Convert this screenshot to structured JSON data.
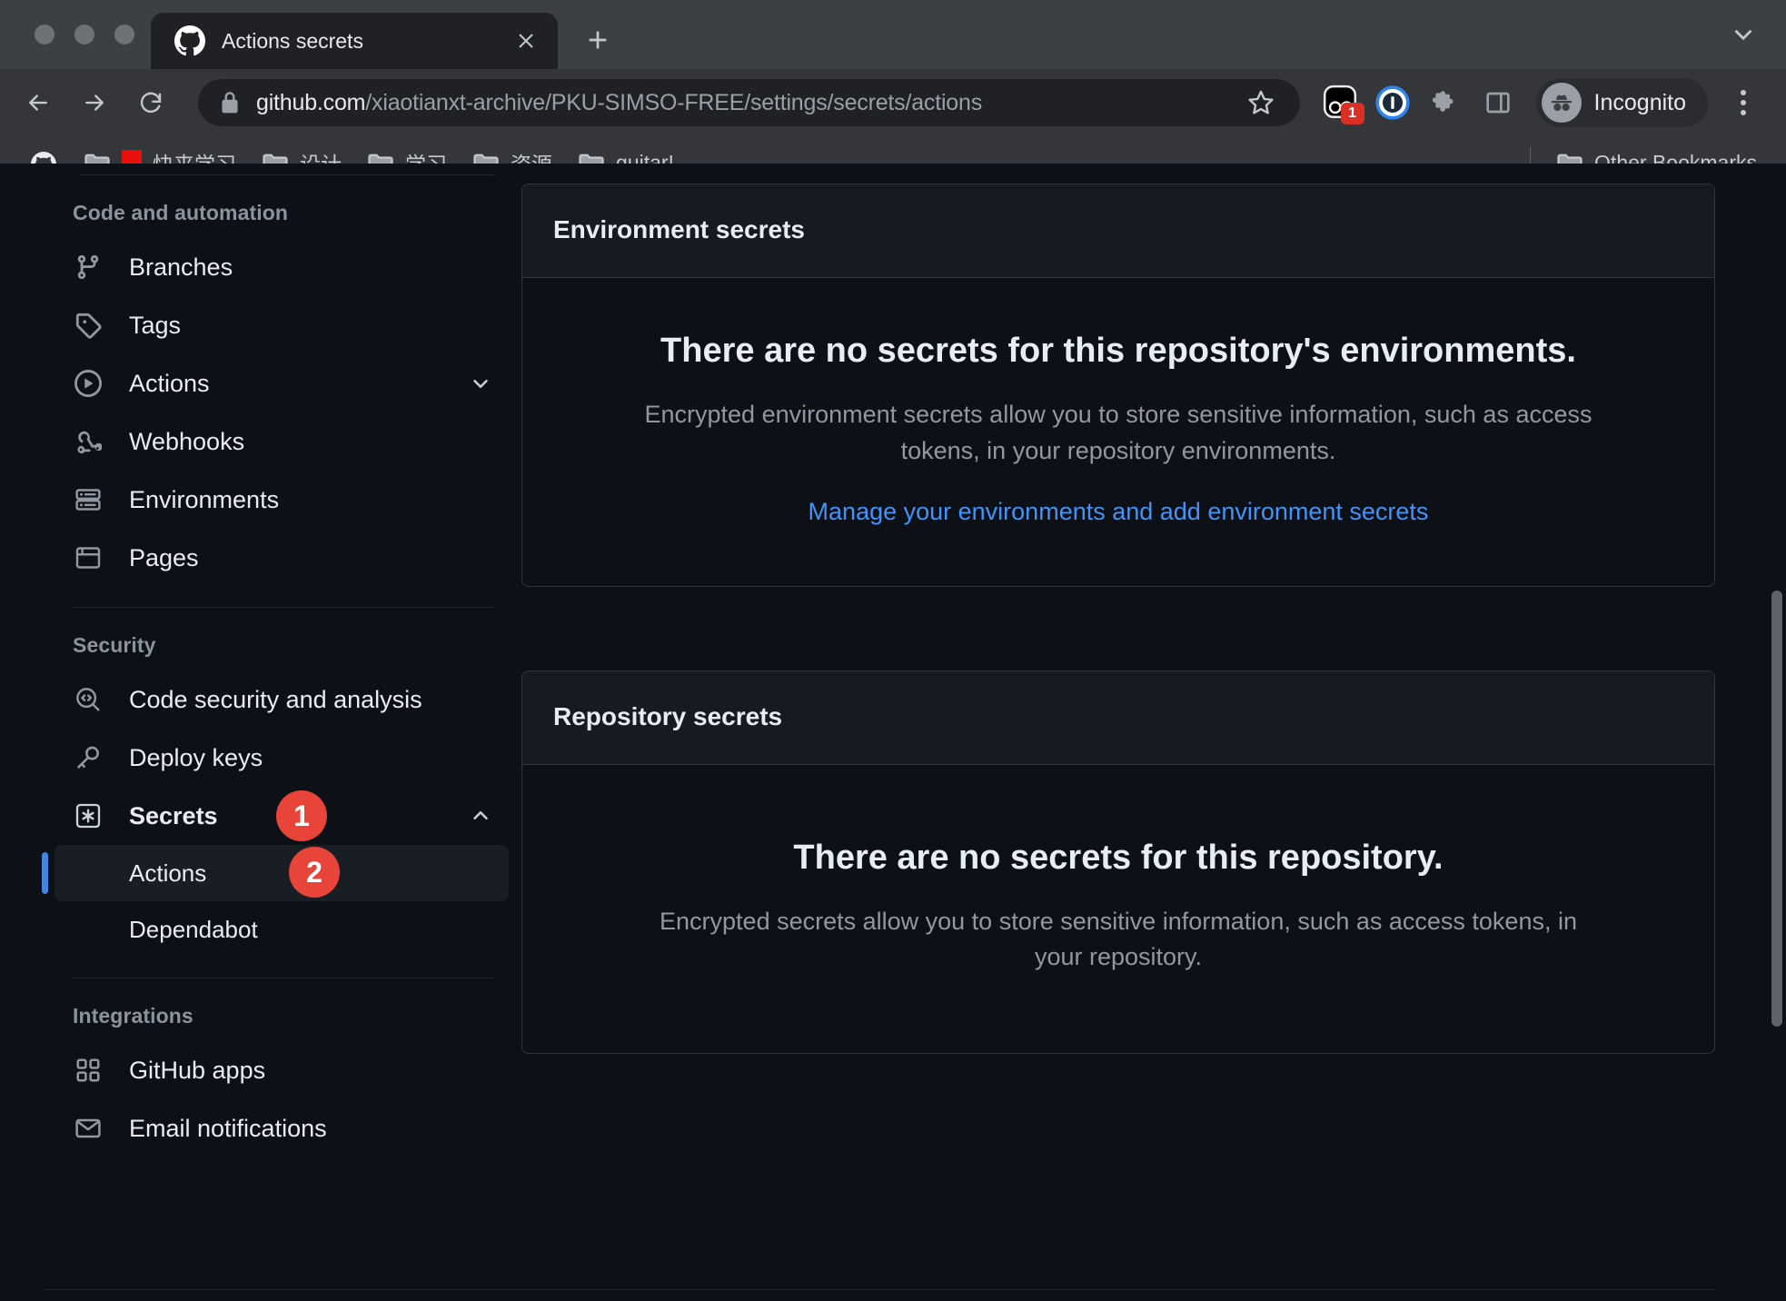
{
  "browser": {
    "tab": {
      "title": "Actions secrets",
      "favicon": "github-icon",
      "close": "close-icon"
    },
    "new_tab_label": "+",
    "nav": {
      "back": "back-arrow-icon",
      "forward": "forward-arrow-icon",
      "reload": "reload-icon"
    },
    "omnibox": {
      "lock": "lock-icon",
      "url_host": "github.com",
      "url_path": "/xiaotianxt-archive/PKU-SIMSO-FREE/settings/secrets/actions",
      "full_url": "github.com/xiaotianxt-archive/PKU-SIMSO-FREE/settings/secrets/actions",
      "bookmark": "star-icon"
    },
    "extensions": [
      {
        "name": "extension-icon-black",
        "badge": "1"
      },
      {
        "name": "onepassword-icon",
        "badge": ""
      },
      {
        "name": "puzzle-icon",
        "badge": ""
      },
      {
        "name": "side-panel-icon",
        "badge": ""
      }
    ],
    "profile": {
      "label": "Incognito",
      "icon": "incognito-icon"
    },
    "menu": "three-dot-menu-icon",
    "bookmarks": [
      {
        "icon": "github-icon",
        "label": "",
        "red_square": false
      },
      {
        "icon": "folder-icon",
        "label": "快来学习",
        "red_square": true
      },
      {
        "icon": "folder-icon",
        "label": "设计",
        "red_square": false
      },
      {
        "icon": "folder-icon",
        "label": "学习",
        "red_square": false
      },
      {
        "icon": "folder-icon",
        "label": "资源",
        "red_square": false
      },
      {
        "icon": "folder-icon",
        "label": "guitar!",
        "red_square": false
      }
    ],
    "other_bookmarks": {
      "label": "Other Bookmarks",
      "icon": "folder-icon"
    }
  },
  "sidebar": {
    "groups": [
      {
        "title": "Code and automation",
        "items": [
          {
            "label": "Branches",
            "icon": "branch-icon",
            "chevron": false
          },
          {
            "label": "Tags",
            "icon": "tag-icon",
            "chevron": false
          },
          {
            "label": "Actions",
            "icon": "play-circle-icon",
            "chevron": "down"
          },
          {
            "label": "Webhooks",
            "icon": "webhook-icon",
            "chevron": false
          },
          {
            "label": "Environments",
            "icon": "server-icon",
            "chevron": false
          },
          {
            "label": "Pages",
            "icon": "browser-window-icon",
            "chevron": false
          }
        ]
      },
      {
        "title": "Security",
        "items": [
          {
            "label": "Code security and analysis",
            "icon": "code-scan-icon",
            "chevron": false
          },
          {
            "label": "Deploy keys",
            "icon": "key-icon",
            "chevron": false
          },
          {
            "label": "Secrets",
            "icon": "asterisk-box-icon",
            "chevron": "up",
            "badge": "1"
          }
        ],
        "subitems": [
          {
            "label": "Actions",
            "active": true,
            "badge": "2"
          },
          {
            "label": "Dependabot",
            "active": false
          }
        ]
      },
      {
        "title": "Integrations",
        "items": [
          {
            "label": "GitHub apps",
            "icon": "apps-grid-icon",
            "chevron": false
          },
          {
            "label": "Email notifications",
            "icon": "mail-icon",
            "chevron": false
          }
        ]
      }
    ]
  },
  "main": {
    "environment_card": {
      "header": "Environment secrets",
      "title": "There are no secrets for this repository's environments.",
      "description": "Encrypted environment secrets allow you to store sensitive information, such as access tokens, in your repository environments.",
      "link": "Manage your environments and add environment secrets"
    },
    "repository_card": {
      "header": "Repository secrets",
      "title": "There are no secrets for this repository.",
      "description": "Encrypted secrets allow you to store sensitive information, such as access tokens, in your repository."
    }
  },
  "colors": {
    "accent_link": "#4493f8",
    "badge_red": "#e8443a",
    "active_rail": "#4184e4",
    "page_bg": "#0d1117",
    "card_header_bg": "#161b22",
    "border": "#30363d"
  }
}
